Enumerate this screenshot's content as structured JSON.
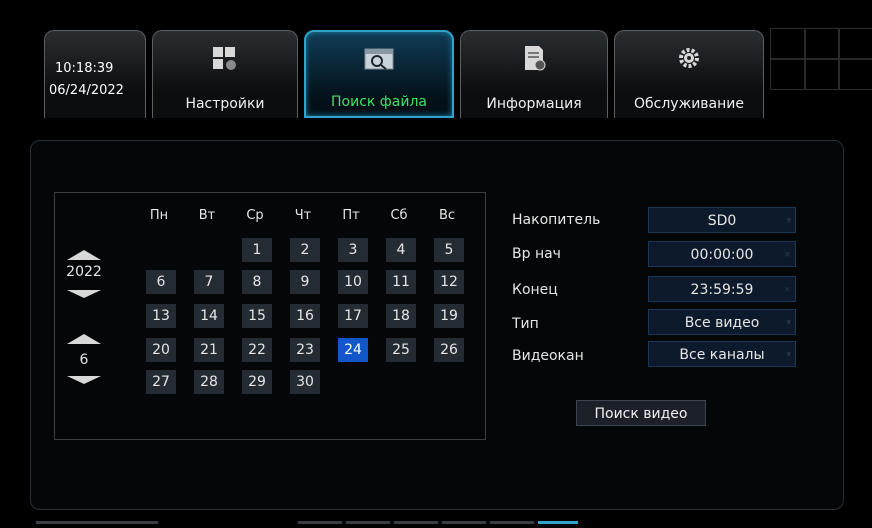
{
  "header": {
    "time": "10:18:39",
    "date": "06/24/2022",
    "tabs": [
      {
        "label": "Настройки",
        "icon": "settings-icon"
      },
      {
        "label": "Поиск файла",
        "icon": "file-search-icon",
        "active": true
      },
      {
        "label": "Информация",
        "icon": "info-document-icon"
      },
      {
        "label": "Обслуживание",
        "icon": "gear-icon"
      }
    ]
  },
  "calendar": {
    "year": "2022",
    "month": "6",
    "weekdays": [
      "Пн",
      "Вт",
      "Ср",
      "Чт",
      "Пт",
      "Сб",
      "Вс"
    ],
    "days": [
      "1",
      "2",
      "3",
      "4",
      "5",
      "6",
      "7",
      "8",
      "9",
      "10",
      "11",
      "12",
      "13",
      "14",
      "15",
      "16",
      "17",
      "18",
      "19",
      "20",
      "21",
      "22",
      "23",
      "24",
      "25",
      "26",
      "27",
      "28",
      "29",
      "30"
    ],
    "selected_day": "24"
  },
  "search_form": {
    "storage_label": "Накопитель",
    "storage_value": "SD0",
    "start_label": "Вр нач",
    "start_value": "00:00:00",
    "end_label": "Конец",
    "end_value": "23:59:59",
    "type_label": "Тип",
    "type_value": "Все видео",
    "channel_label": "Видеокан",
    "channel_value": "Все каналы",
    "search_button": "Поиск видео"
  },
  "colors": {
    "accent_active_tab": "#2fa3c9",
    "active_tab_label": "#3ee06a",
    "selected_day": "#1257c9"
  }
}
